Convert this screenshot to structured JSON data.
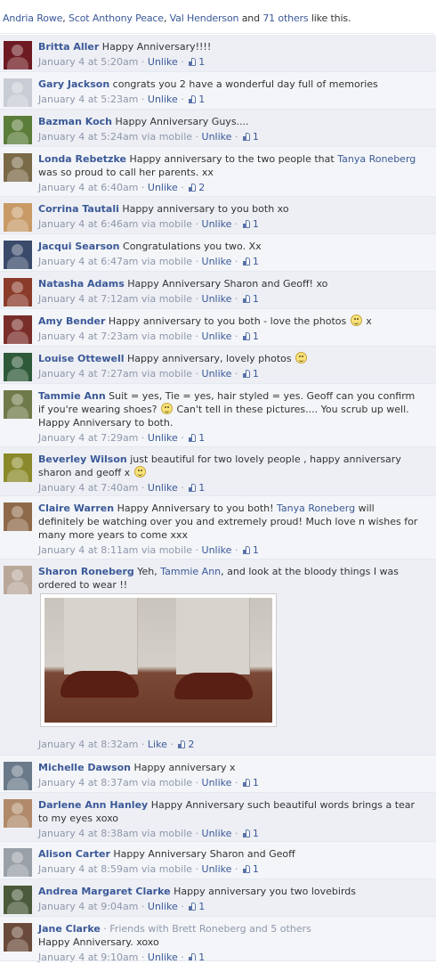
{
  "likes_bar": {
    "names": [
      "Andria Rowe",
      "Scot Anthony Peace",
      "Val Henderson"
    ],
    "and_text": " and ",
    "others_label": "71 others",
    "suffix": " like this."
  },
  "comments": [
    {
      "author": "Britta Aller",
      "text": "Happy Anniversary!!!!",
      "time": "January 4 at 5:20am",
      "via": "",
      "action": "Unlike",
      "likes": "1",
      "avatar": "#6e1a22"
    },
    {
      "author": "Gary Jackson",
      "text": "congrats you 2 have a wonderful day full of memories",
      "time": "January 4 at 5:23am",
      "via": "",
      "action": "Unlike",
      "likes": "1",
      "avatar": "#c8ccd4"
    },
    {
      "author": "Bazman Koch",
      "text": "Happy Anniversary Guys....",
      "time": "January 4 at 5:24am",
      "via": " via mobile",
      "action": "Unlike",
      "likes": "1",
      "avatar": "#5b7d3a"
    },
    {
      "author": "Londa Rebetzke",
      "text_parts": [
        "Happy anniversary to the two people that ",
        "Tanya Roneberg",
        " was so proud to call her parents. xx"
      ],
      "time": "January 4 at 6:40am",
      "via": "",
      "action": "Unlike",
      "likes": "2",
      "avatar": "#7b6a48"
    },
    {
      "author": "Corrina Tautali",
      "text": "Happy anniversary to you both xo",
      "time": "January 4 at 6:46am",
      "via": " via mobile",
      "action": "Unlike",
      "likes": "1",
      "avatar": "#c79a66"
    },
    {
      "author": "Jacqui Searson",
      "text": "Congratulations you two. Xx",
      "time": "January 4 at 6:47am",
      "via": " via mobile",
      "action": "Unlike",
      "likes": "1",
      "avatar": "#3a4a6a"
    },
    {
      "author": "Natasha Adams",
      "text": "Happy Anniversary Sharon and Geoff! xo",
      "time": "January 4 at 7:12am",
      "via": " via mobile",
      "action": "Unlike",
      "likes": "1",
      "avatar": "#8a3b2a"
    },
    {
      "author": "Amy Bender",
      "text_before": "Happy anniversary to you both - love the photos ",
      "text_after": " x",
      "smiley": true,
      "time": "January 4 at 7:23am",
      "via": " via mobile",
      "action": "Unlike",
      "likes": "1",
      "avatar": "#7a2e2a"
    },
    {
      "author": "Louise Ottewell",
      "text_before": "Happy anniversary, lovely photos ",
      "text_after": "",
      "smiley": true,
      "time": "January 4 at 7:27am",
      "via": " via mobile",
      "action": "Unlike",
      "likes": "1",
      "avatar": "#2f5a3a"
    },
    {
      "author": "Tammie Ann",
      "text_before": "Suit = yes, Tie = yes, hair styled = yes. Geoff can you confirm if you're wearing shoes? ",
      "text_after": " Can't tell in these pictures.... You scrub up well. Happy Anniversary to both.",
      "smiley": true,
      "time": "January 4 at 7:29am",
      "via": "",
      "action": "Unlike",
      "likes": "1",
      "avatar": "#6f7a4a"
    },
    {
      "author": "Beverley Wilson",
      "text_before": "just beautiful for two lovely people , happy anniversary sharon and geoff x ",
      "text_after": "",
      "smiley": true,
      "time": "January 4 at 7:40am",
      "via": "",
      "action": "Unlike",
      "likes": "1",
      "avatar": "#8a8a2a"
    },
    {
      "author": "Claire Warren",
      "text_parts": [
        "Happy Anniversary to you both! ",
        "Tanya Roneberg",
        " will definitely be watching over you and extremely proud! Much love n wishes for many more years to come xxx"
      ],
      "time": "January 4 at 8:11am",
      "via": " via mobile",
      "action": "Unlike",
      "likes": "1",
      "avatar": "#8f6a4a"
    },
    {
      "author": "Sharon Roneberg",
      "text_parts": [
        "Yeh, ",
        "Tammie Ann",
        ", and look at the bloody things I was ordered to wear !!"
      ],
      "time": "January 4 at 8:32am",
      "via": "",
      "action": "Like",
      "likes": "2",
      "avatar": "#b9a79a",
      "has_photo": true
    },
    {
      "author": "Michelle Dawson",
      "text": "Happy anniversary x",
      "time": "January 4 at 8:37am",
      "via": " via mobile",
      "action": "Unlike",
      "likes": "1",
      "avatar": "#6a7a8a"
    },
    {
      "author": "Darlene Ann Hanley",
      "text": "Happy Anniversary such beautiful words brings a tear to my eyes xoxo",
      "time": "January 4 at 8:38am",
      "via": " via mobile",
      "action": "Unlike",
      "likes": "1",
      "avatar": "#b08a6a"
    },
    {
      "author": "Alison Carter",
      "text": "Happy Anniversary Sharon and Geoff",
      "time": "January 4 at 8:59am",
      "via": " via mobile",
      "action": "Unlike",
      "likes": "1",
      "avatar": "#9aa0a8"
    },
    {
      "author": "Andrea Margaret Clarke",
      "text": "Happy anniversary you two lovebirds",
      "time": "January 4 at 9:04am",
      "via": "",
      "action": "Unlike",
      "likes": "1",
      "avatar": "#4a5a3a"
    },
    {
      "author": "Jane Clarke",
      "friends_note": " · Friends with Brett Roneberg and 5 others",
      "text": "Happy Anniversary. xoxo",
      "time": "January 4 at 9:10am",
      "via": "",
      "action": "Unlike",
      "likes": "1",
      "avatar": "#6a4a3a"
    }
  ]
}
